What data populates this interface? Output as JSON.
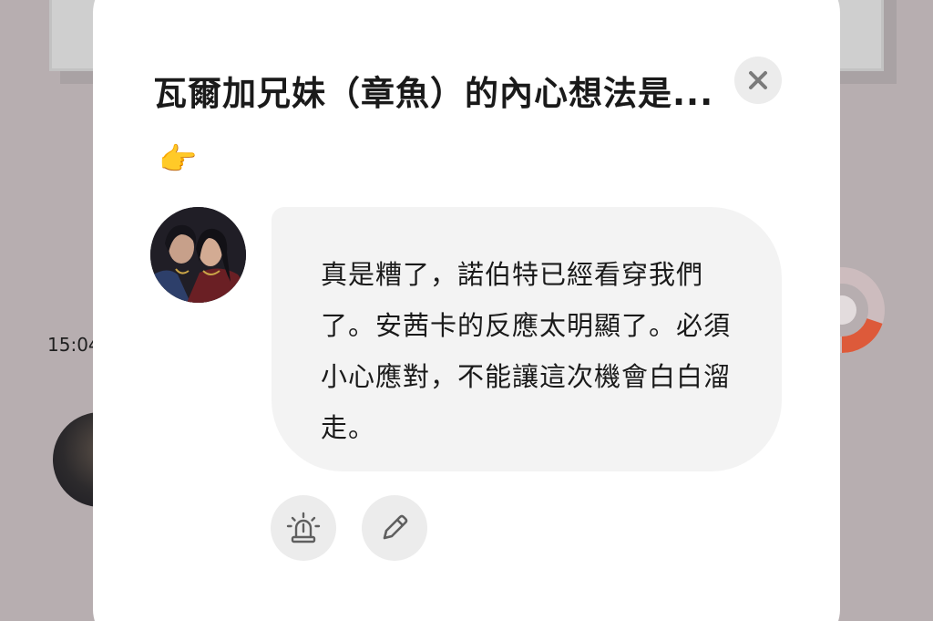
{
  "background": {
    "timestamp": "15:04"
  },
  "modal": {
    "title": "瓦爾加兄妹（章魚）的內心想法是...",
    "title_emoji": "👉",
    "message": "真是糟了，諾伯特已經看穿我們了。安茜卡的反應太明顯了。必須小心應對，不能讓這次機會白白溜走。"
  },
  "icons": {
    "close": "close-icon",
    "alarm": "alarm-light-icon",
    "edit": "pencil-icon"
  },
  "colors": {
    "overlay": "#b7aeb0",
    "modal_bg": "#ffffff",
    "bubble_bg": "#f3f3f3",
    "button_bg": "#ececec",
    "icon_gray": "#5f5f5f",
    "accent_orange": "#dd5a3a"
  }
}
